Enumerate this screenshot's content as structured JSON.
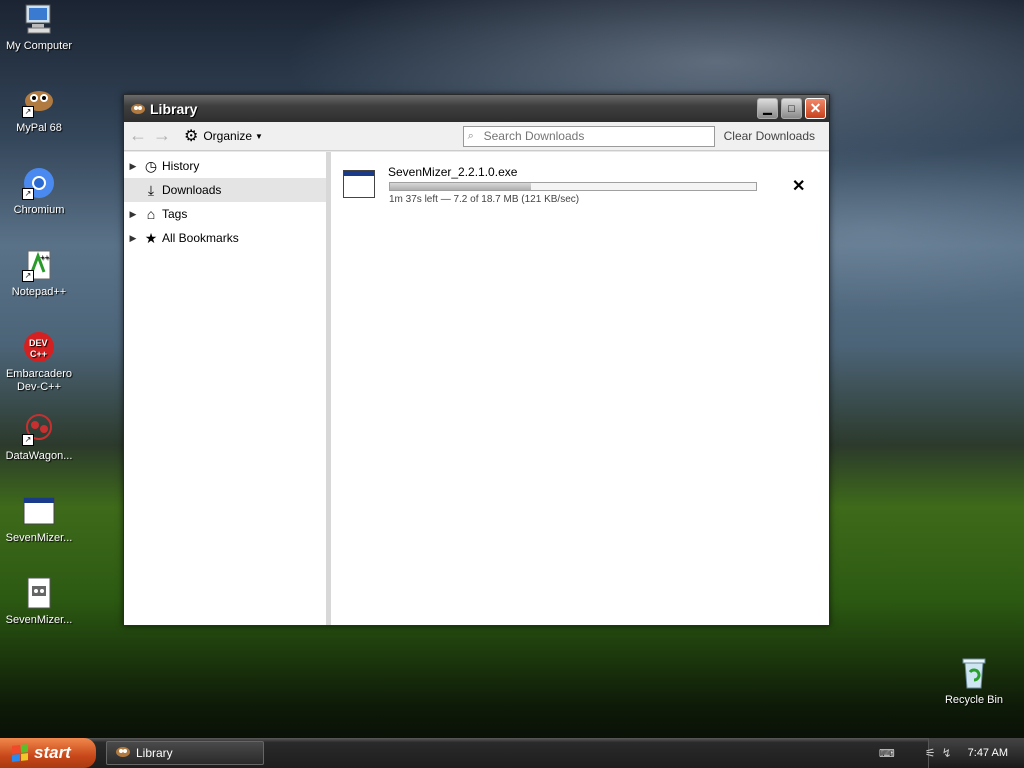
{
  "desktop": {
    "icons": [
      {
        "label": "My Computer"
      },
      {
        "label": "MyPal 68"
      },
      {
        "label": "Chromium"
      },
      {
        "label": "Notepad++"
      },
      {
        "label": "Embarcadero Dev-C++"
      },
      {
        "label": "DataWagon..."
      },
      {
        "label": "SevenMizer..."
      },
      {
        "label": "SevenMizer..."
      },
      {
        "label": "Recycle Bin"
      }
    ]
  },
  "window": {
    "title": "Library",
    "toolbar": {
      "organize_label": "Organize",
      "search_placeholder": "Search Downloads",
      "clear_label": "Clear Downloads"
    },
    "sidebar": {
      "items": [
        {
          "label": "History",
          "icon": "clock-icon"
        },
        {
          "label": "Downloads",
          "icon": "download-icon",
          "selected": true
        },
        {
          "label": "Tags",
          "icon": "tag-icon"
        },
        {
          "label": "All Bookmarks",
          "icon": "star-icon"
        }
      ]
    },
    "downloads": [
      {
        "filename": "SevenMizer_2.2.1.0.exe",
        "status": "1m 37s left — 7.2 of 18.7 MB (121 KB/sec)",
        "progress": 0.385
      }
    ]
  },
  "taskbar": {
    "start_label": "start",
    "task_label": "Library",
    "clock": "7:47 AM"
  }
}
